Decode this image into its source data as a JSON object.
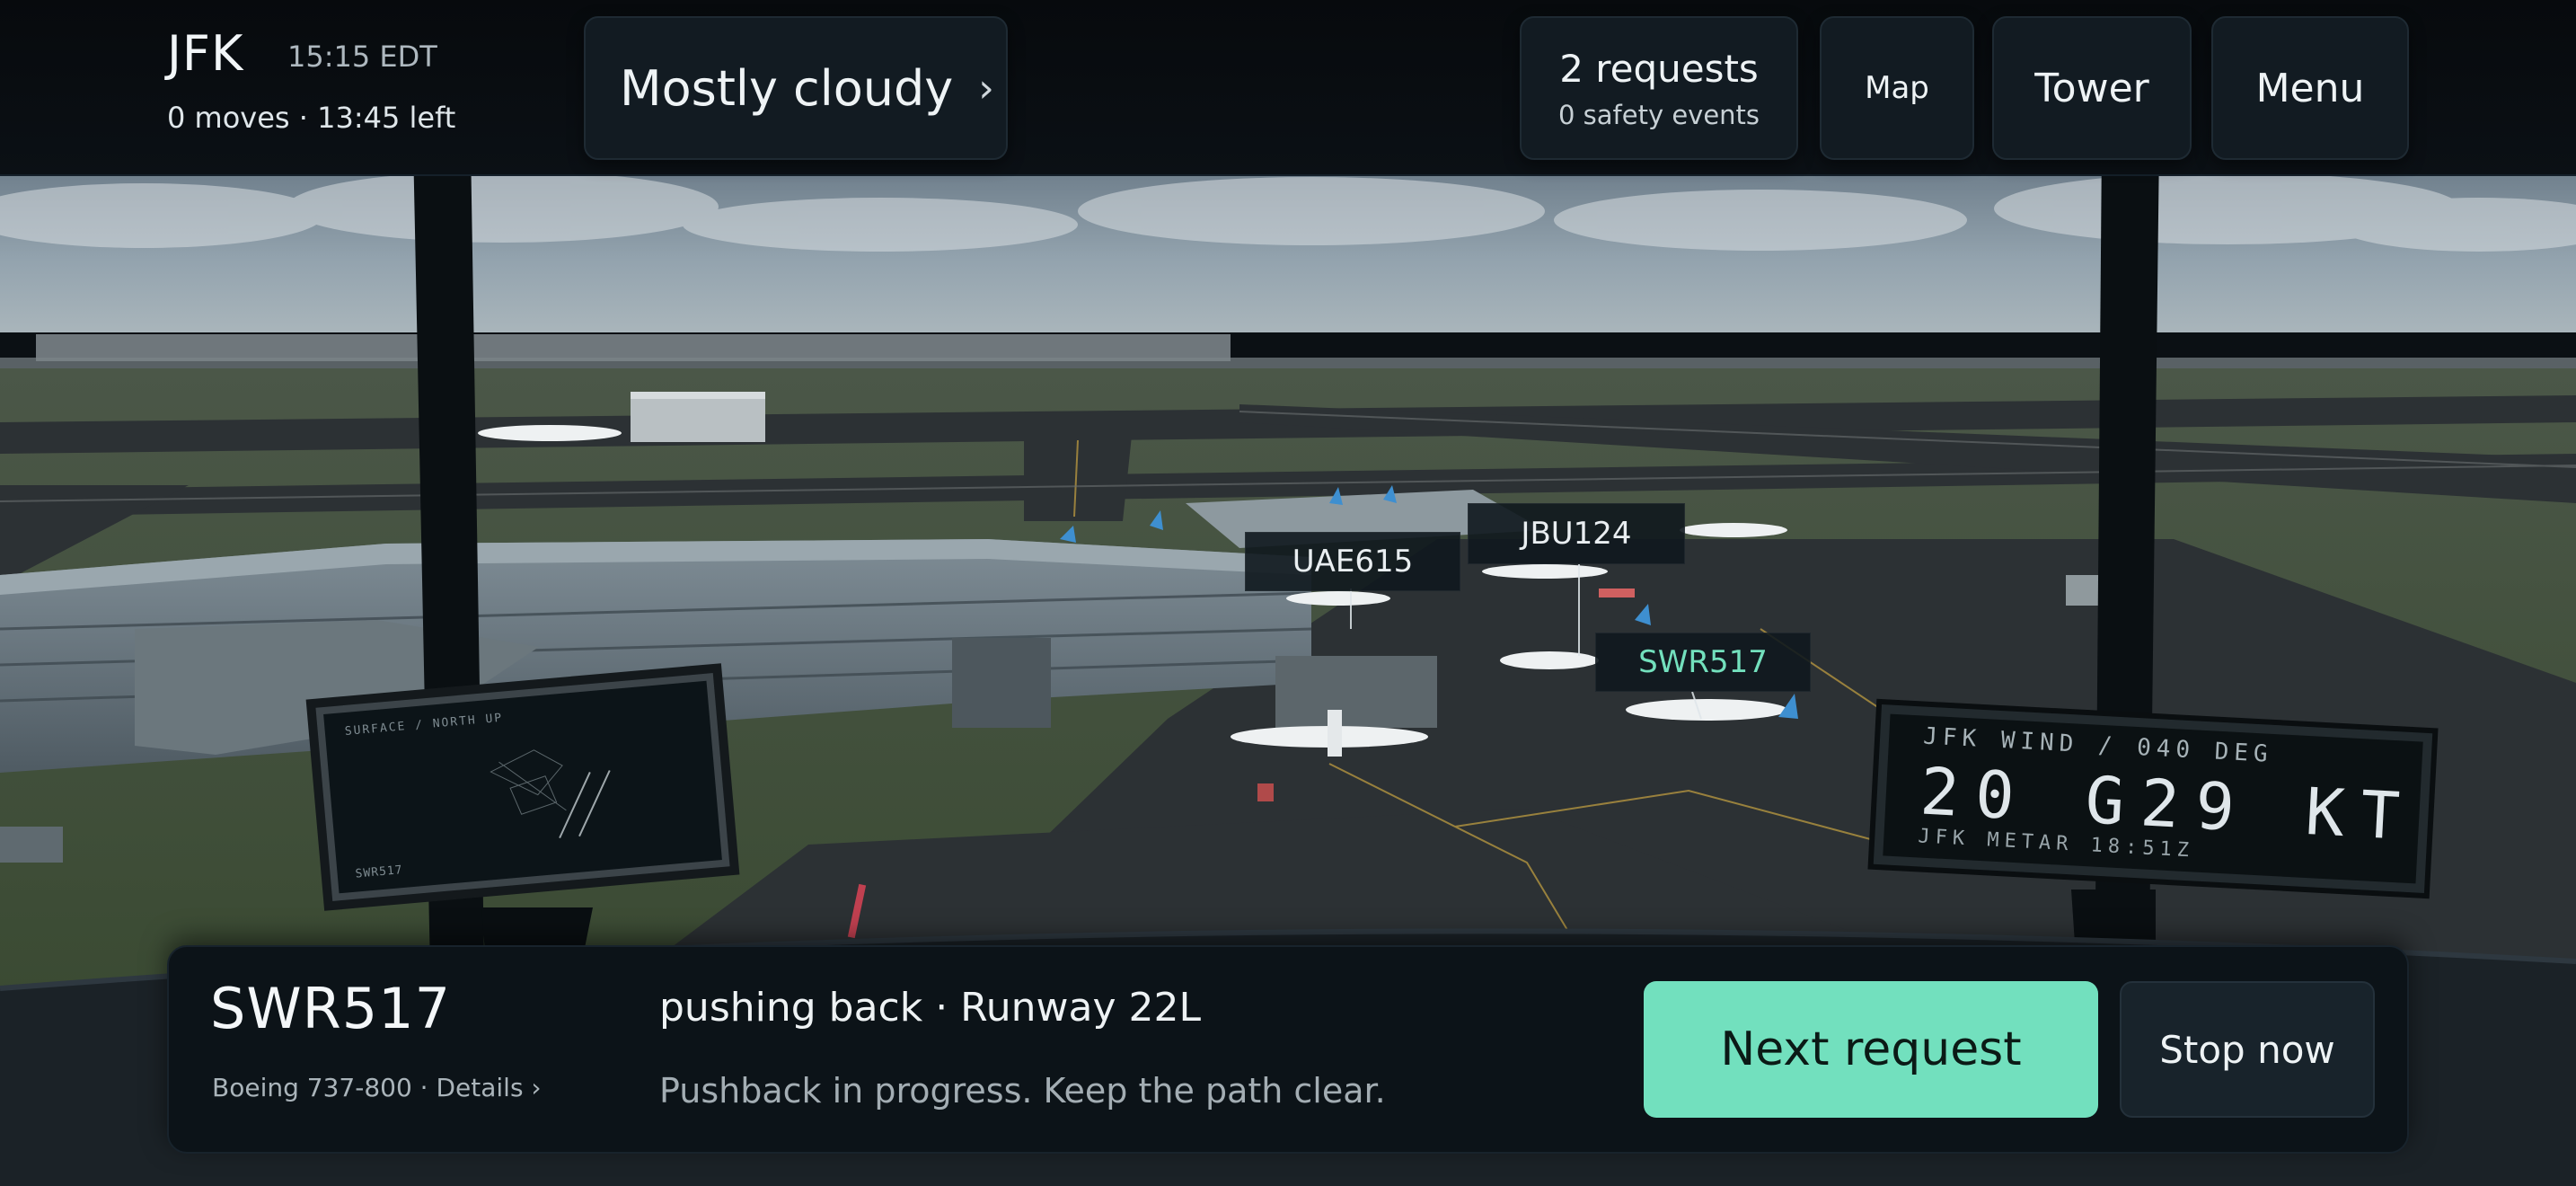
{
  "header": {
    "airport": "JFK",
    "time": "15:15 EDT",
    "session_status": "0 moves · 13:45 left",
    "weather_label": "Mostly cloudy",
    "weather_chevron": "›",
    "requests_count": "2 requests",
    "safety_events": "0 safety events",
    "map_label": "Map",
    "tower_label": "Tower",
    "menu_label": "Menu"
  },
  "aircraft_tags": [
    {
      "callsign": "UAE615",
      "selected": false
    },
    {
      "callsign": "JBU124",
      "selected": false
    },
    {
      "callsign": "SWR517",
      "selected": true
    }
  ],
  "radar_display": {
    "caption": "SURFACE / NORTH UP",
    "callsign": "SWR517"
  },
  "wind_display": {
    "line1": "JFK WIND / 040 DEG",
    "line2": "20 G29 KT",
    "line3": "JFK METAR  18:51Z"
  },
  "selected_flight": {
    "callsign": "SWR517",
    "type_details": "Boeing 737-800 · Details ›",
    "status": "pushing back · Runway 22L",
    "message": "Pushback in progress. Keep the path clear.",
    "next_request_label": "Next request",
    "stop_label": "Stop now"
  },
  "colors": {
    "accent": "#72e0be",
    "selected_tag_text": "#73e0bd",
    "panel_bg": "#0c1318",
    "chip_bg": "#121b22"
  }
}
